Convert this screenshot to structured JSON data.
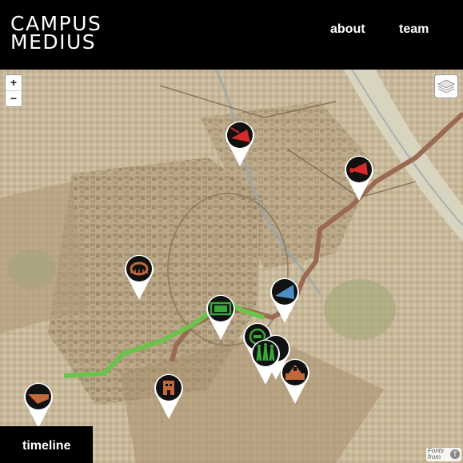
{
  "brand": {
    "line1": "CAMPUS",
    "line2": "MEDIUS"
  },
  "nav": {
    "about": "about",
    "team": "team"
  },
  "map_controls": {
    "zoom_in": "+",
    "zoom_out": "−"
  },
  "timeline": {
    "label": "timeline"
  },
  "attribution": {
    "line1": "Fonts",
    "line2": "from",
    "logo": "T"
  },
  "colors": {
    "header_bg": "#000000",
    "route_green": "#6cc24a",
    "route_brown": "#a07058",
    "marker_red": "#d42a2a",
    "marker_blue": "#4a8ec4",
    "marker_green": "#3aa63a",
    "marker_orange": "#c2683a"
  },
  "markers": [
    {
      "icon": "red-radar-icon"
    },
    {
      "icon": "red-megaphone-icon"
    },
    {
      "icon": "stadium-icon"
    },
    {
      "icon": "blue-searchlight-icon"
    },
    {
      "icon": "green-screen-icon"
    },
    {
      "icon": "green-radio-icon"
    },
    {
      "icon": "green-crowd-icon"
    },
    {
      "icon": "orange-monument-icon"
    },
    {
      "icon": "orange-building-icon"
    },
    {
      "icon": "orange-ramp-icon"
    },
    {
      "icon": "green-tent-icon"
    }
  ]
}
